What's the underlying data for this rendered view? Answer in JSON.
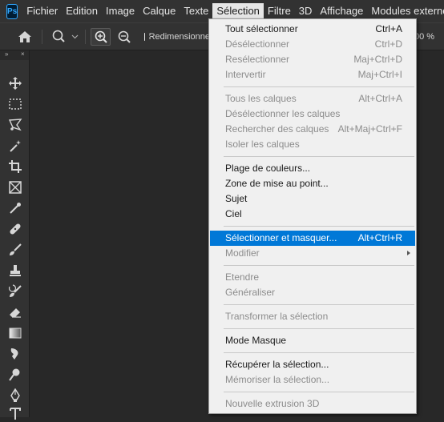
{
  "app": {
    "logo_text": "Ps"
  },
  "menubar": {
    "items": [
      "Fichier",
      "Edition",
      "Image",
      "Calque",
      "Texte",
      "Sélection",
      "Filtre",
      "3D",
      "Affichage",
      "Modules externes"
    ],
    "active_index": 5
  },
  "options_bar": {
    "resize_label": "Redimensionne",
    "resize_checked": true,
    "zoom_percent": "00 %"
  },
  "toolbox": {
    "collapse_glyph": "»",
    "close_glyph": "×",
    "tools": [
      "move-tool-icon",
      "rectangular-marquee-icon",
      "lasso-icon",
      "magic-wand-icon",
      "crop-icon",
      "frame-icon",
      "eyedropper-icon",
      "healing-brush-icon",
      "brush-icon",
      "clone-stamp-icon",
      "history-brush-icon",
      "eraser-icon",
      "gradient-icon",
      "smudge-icon",
      "dodge-icon",
      "pen-icon",
      "type-icon"
    ]
  },
  "selection_menu": {
    "groups": [
      [
        {
          "label": "Tout sélectionner",
          "shortcut": "Ctrl+A",
          "disabled": false
        },
        {
          "label": "Désélectionner",
          "shortcut": "Ctrl+D",
          "disabled": true
        },
        {
          "label": "Resélectionner",
          "shortcut": "Maj+Ctrl+D",
          "disabled": true
        },
        {
          "label": "Intervertir",
          "shortcut": "Maj+Ctrl+I",
          "disabled": true
        }
      ],
      [
        {
          "label": "Tous les calques",
          "shortcut": "Alt+Ctrl+A",
          "disabled": true
        },
        {
          "label": "Désélectionner les calques",
          "shortcut": "",
          "disabled": true
        },
        {
          "label": "Rechercher des calques",
          "shortcut": "Alt+Maj+Ctrl+F",
          "disabled": true
        },
        {
          "label": "Isoler les calques",
          "shortcut": "",
          "disabled": true
        }
      ],
      [
        {
          "label": "Plage de couleurs...",
          "shortcut": "",
          "disabled": false
        },
        {
          "label": "Zone de mise au point...",
          "shortcut": "",
          "disabled": false
        },
        {
          "label": "Sujet",
          "shortcut": "",
          "disabled": false
        },
        {
          "label": "Ciel",
          "shortcut": "",
          "disabled": false
        }
      ],
      [
        {
          "label": "Sélectionner et masquer...",
          "shortcut": "Alt+Ctrl+R",
          "disabled": false,
          "highlighted": true
        },
        {
          "label": "Modifier",
          "shortcut": "",
          "disabled": true,
          "submenu": true
        }
      ],
      [
        {
          "label": "Etendre",
          "shortcut": "",
          "disabled": true
        },
        {
          "label": "Généraliser",
          "shortcut": "",
          "disabled": true
        }
      ],
      [
        {
          "label": "Transformer la sélection",
          "shortcut": "",
          "disabled": true
        }
      ],
      [
        {
          "label": "Mode Masque",
          "shortcut": "",
          "disabled": false
        }
      ],
      [
        {
          "label": "Récupérer la sélection...",
          "shortcut": "",
          "disabled": false
        },
        {
          "label": "Mémoriser la sélection...",
          "shortcut": "",
          "disabled": true
        }
      ],
      [
        {
          "label": "Nouvelle extrusion 3D",
          "shortcut": "",
          "disabled": true
        }
      ]
    ]
  },
  "colors": {
    "highlight": "#0078d7",
    "menu_bg": "#f0f0f0",
    "disabled_text": "#8c8c8c",
    "chrome_bg": "#323232",
    "canvas_bg": "#282828"
  }
}
